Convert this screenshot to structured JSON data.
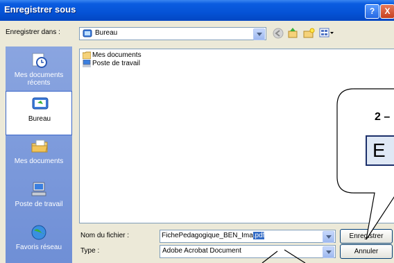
{
  "window": {
    "title": "Enregistrer sous",
    "help_label": "?",
    "close_label": "X"
  },
  "toolbar": {
    "save_in_label": "Enregistrer dans :",
    "location_value": "Bureau"
  },
  "places": [
    {
      "label": "Mes documents récents",
      "icon": "recent-documents-icon"
    },
    {
      "label": "Bureau",
      "icon": "desktop-icon"
    },
    {
      "label": "Mes documents",
      "icon": "my-documents-icon"
    },
    {
      "label": "Poste de travail",
      "icon": "my-computer-icon"
    },
    {
      "label": "Favoris réseau",
      "icon": "network-places-icon"
    }
  ],
  "files": [
    {
      "name": "Mes documents",
      "icon": "folder-icon"
    },
    {
      "name": "Poste de travail",
      "icon": "computer-icon"
    }
  ],
  "form": {
    "filename_label": "Nom du fichier :",
    "filename_value": "FichePedagogique_BEN_Ima",
    "filename_selected": ".pdf",
    "type_label": "Type :",
    "type_value": "Adobe Acrobat Document"
  },
  "buttons": {
    "save_label": "Enregistrer",
    "cancel_label": "Annuler"
  },
  "callout": {
    "step_text": "2 –",
    "box_text": "E"
  },
  "colors": {
    "title_bar": "#0553d6",
    "places_bar": "#7b96d8",
    "dialog_bg": "#ece9d8"
  }
}
